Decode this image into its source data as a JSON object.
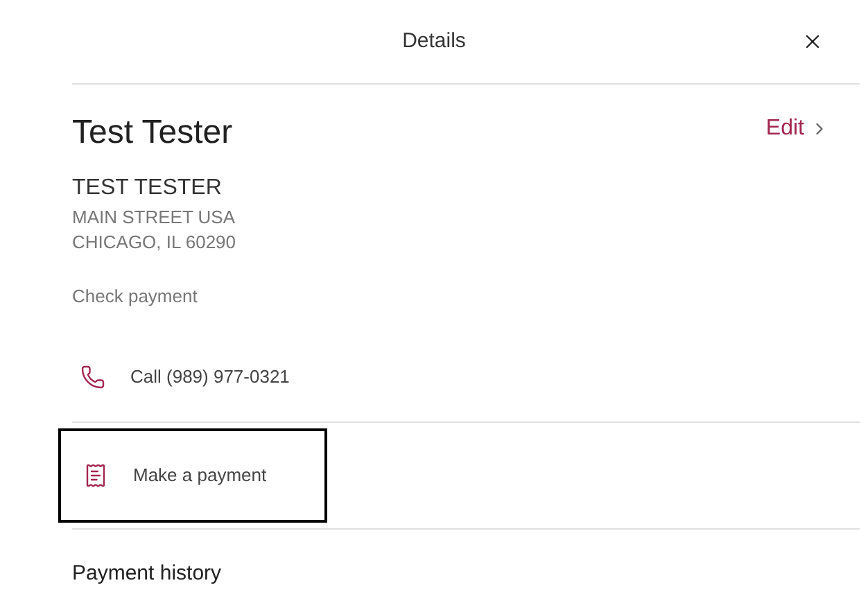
{
  "header": {
    "title": "Details"
  },
  "customer": {
    "name": "Test Tester",
    "edit_link": "Edit",
    "mailing_name": "TEST TESTER",
    "address_lines": [
      "MAIN STREET USA",
      "CHICAGO, IL 60290"
    ],
    "payment_method": "Check payment"
  },
  "actions": [
    {
      "kind": "call",
      "label": "Call (989) 977-0321",
      "focused": false
    },
    {
      "kind": "payment",
      "label": "Make a payment",
      "focused": true
    }
  ],
  "section_heading": "Payment history"
}
